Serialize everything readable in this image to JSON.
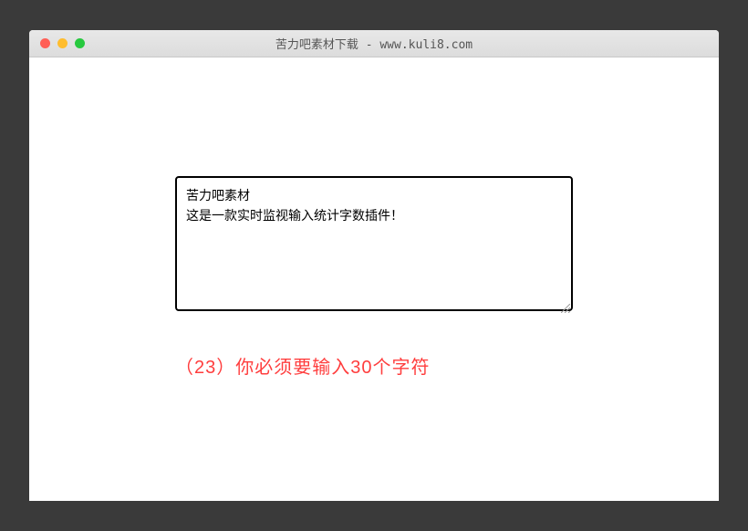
{
  "window": {
    "title": "苦力吧素材下载 - www.kuli8.com"
  },
  "textarea": {
    "value": "苦力吧素材\n这是一款实时监视输入统计字数插件！"
  },
  "counter": {
    "count": "23",
    "message": "你必须要输入30个字符",
    "full_text": "（23）你必须要输入30个字符"
  }
}
